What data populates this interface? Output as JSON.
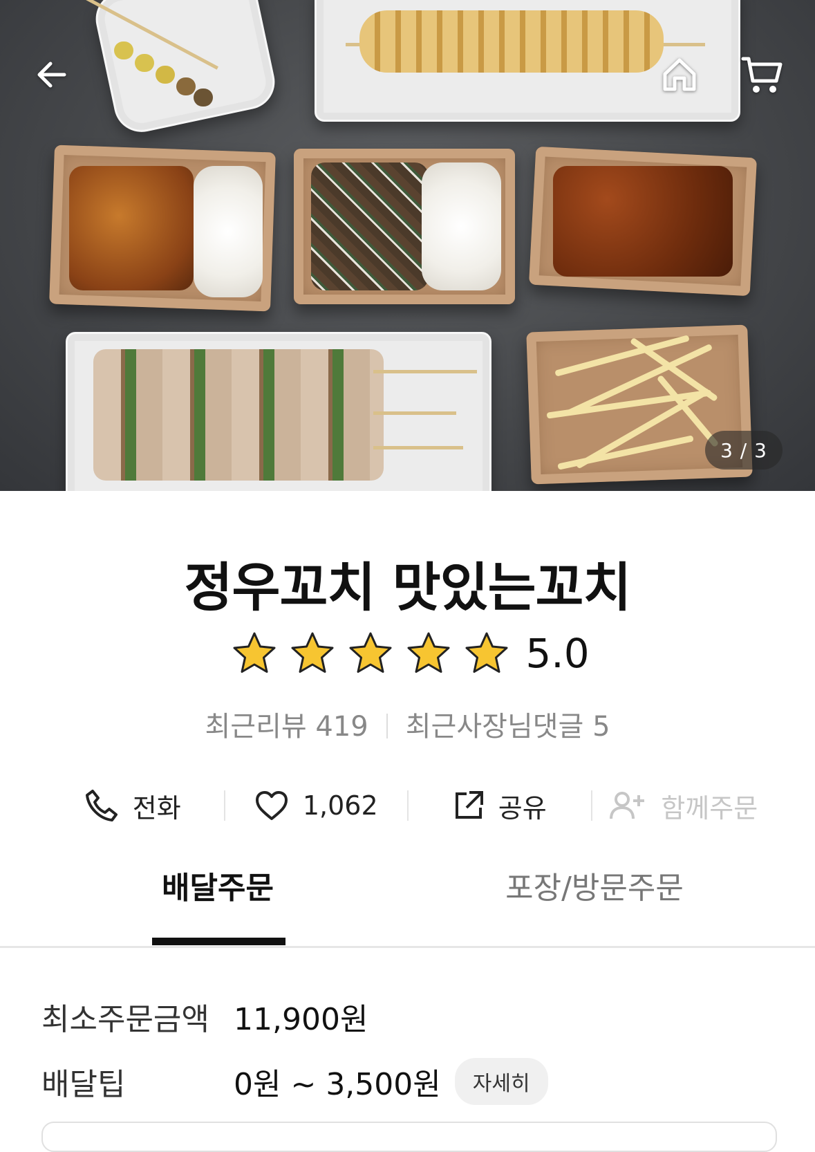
{
  "hero": {
    "page_indicator": "3 / 3",
    "icons": {
      "back": "back-arrow-icon",
      "home": "home-icon",
      "cart": "cart-icon"
    }
  },
  "store": {
    "name": "정우꼬치 맛있는꼬치",
    "rating": "5.0",
    "stars": 5,
    "review_text": "최근리뷰 419",
    "owner_reply_text": "최근사장님댓글 5"
  },
  "actions": [
    {
      "label": "전화",
      "icon": "phone-icon",
      "enabled": true
    },
    {
      "label": "1,062",
      "icon": "heart-icon",
      "enabled": true
    },
    {
      "label": "공유",
      "icon": "share-icon",
      "enabled": true
    },
    {
      "label": "함께주문",
      "icon": "add-person-icon",
      "enabled": false
    }
  ],
  "tabs": [
    {
      "label": "배달주문",
      "active": true
    },
    {
      "label": "포장/방문주문",
      "active": false
    }
  ],
  "info": {
    "min_order_label": "최소주문금액",
    "min_order_value": "11,900원",
    "delivery_tip_label": "배달팁",
    "delivery_tip_value": "0원 ~ 3,500원",
    "detail_button": "자세히"
  },
  "colors": {
    "star": "#f7c531",
    "accent": "#111111"
  }
}
